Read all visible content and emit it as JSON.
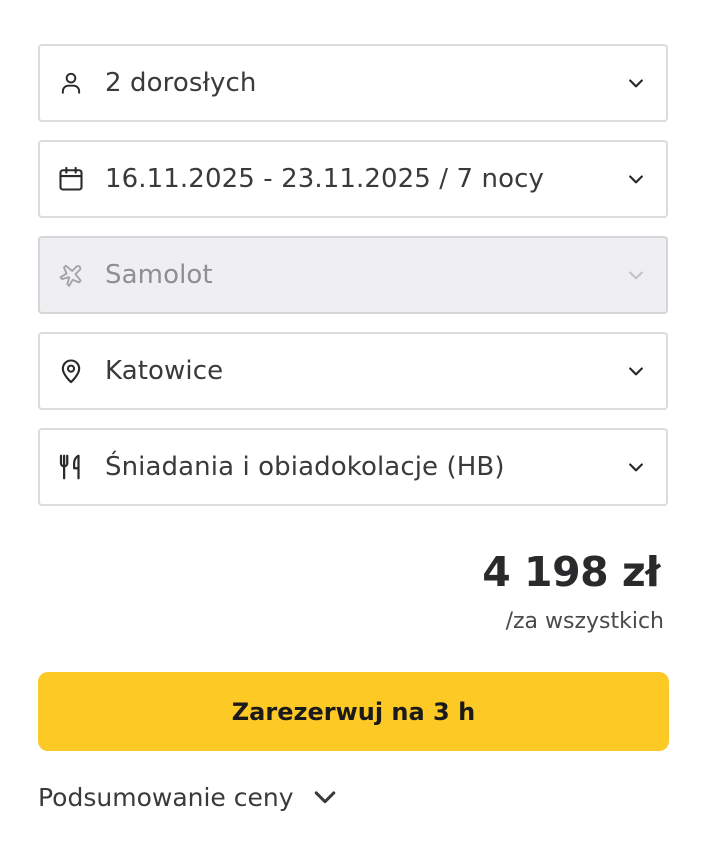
{
  "booking": {
    "guests": {
      "label": "2 dorosłych",
      "icon": "person-icon"
    },
    "dates": {
      "label": "16.11.2025 - 23.11.2025 / 7 nocy",
      "icon": "calendar-icon"
    },
    "transport": {
      "label": "Samolot",
      "icon": "plane-icon",
      "disabled": true
    },
    "departure": {
      "label": "Katowice",
      "icon": "location-pin-icon"
    },
    "board": {
      "label": "Śniadania i obiadokolacje (HB)",
      "icon": "fork-knife-icon"
    }
  },
  "price": {
    "amount": "4 198 zł",
    "note": "/za wszystkich"
  },
  "actions": {
    "book_label": "Zarezerwuj na 3 h",
    "summary_label": "Podsumowanie ceny"
  },
  "colors": {
    "accent": "#fdc925",
    "text": "#3a3a3c",
    "disabled_bg": "#efeef1",
    "border": "#dcdcde"
  }
}
